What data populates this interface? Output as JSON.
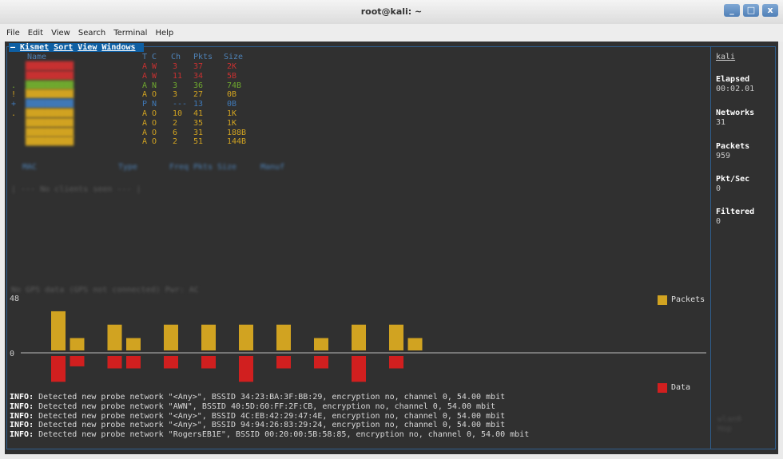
{
  "window": {
    "title": "root@kali: ~",
    "controls": [
      "_",
      "□",
      "x"
    ]
  },
  "menubar": {
    "items": [
      "File",
      "Edit",
      "View",
      "Search",
      "Terminal",
      "Help"
    ]
  },
  "kismet": {
    "menu_items": [
      "Kismet",
      "Sort",
      "View",
      "Windows"
    ],
    "network_headers": {
      "name": "Name",
      "tc": "T C",
      "ch": "Ch",
      "pkts": "Pkts",
      "size": "Size"
    },
    "networks": [
      {
        "marker": " ",
        "name": "blurred",
        "tc": "A W",
        "ch": "3",
        "pkts": "37",
        "size": "2K",
        "color": "#c73131"
      },
      {
        "marker": " ",
        "name": "blurred",
        "tc": "A W",
        "ch": "11",
        "pkts": "34",
        "size": "5B",
        "color": "#c73131"
      },
      {
        "marker": ".",
        "name": "blurred",
        "tc": "A N",
        "ch": "3",
        "pkts": "36",
        "size": "74B",
        "color": "#6fa82f"
      },
      {
        "marker": "!",
        "name": "blurred",
        "tc": "A O",
        "ch": "3",
        "pkts": "27",
        "size": "0B",
        "color": "#d1a321"
      },
      {
        "marker": "+",
        "name": "blurred",
        "tc": "P N",
        "ch": "---",
        "pkts": "13",
        "size": "0B",
        "color": "#3f78b6"
      },
      {
        "marker": ".",
        "name": "blurred",
        "tc": "A O",
        "ch": "10",
        "pkts": "41",
        "size": "1K",
        "color": "#d1a321"
      },
      {
        "marker": " ",
        "name": "blurred",
        "tc": "A O",
        "ch": "2",
        "pkts": "35",
        "size": "1K",
        "color": "#d1a321"
      },
      {
        "marker": " ",
        "name": "blurred",
        "tc": "A O",
        "ch": "6",
        "pkts": "31",
        "size": "188B",
        "color": "#d1a321"
      },
      {
        "marker": " ",
        "name": "blurred",
        "tc": "A O",
        "ch": "2",
        "pkts": "51",
        "size": "144B",
        "color": "#d1a321"
      }
    ],
    "client_headers": [
      "MAC",
      "Type",
      "Freq",
      "Pkts",
      "Size",
      "Manuf"
    ],
    "no_clients": "| --- No clients seen --- |",
    "gps_status": "No GPS data (GPS not connected) Pwr: AC",
    "sidebar": {
      "hostname": "kali",
      "elapsed_label": "Elapsed",
      "elapsed_value": "00:02.01",
      "networks_label": "Networks",
      "networks_value": "31",
      "packets_label": "Packets",
      "packets_value": "959",
      "pktsec_label": "Pkt/Sec",
      "pktsec_value": "0",
      "filtered_label": "Filtered",
      "filtered_value": "0"
    },
    "footer": {
      "iface": "wlan0",
      "mode": "Hop"
    }
  },
  "chart_data": {
    "type": "bar",
    "y_max_label": "48",
    "zero_label": "0",
    "legend": [
      {
        "name": "Packets",
        "color": "#d1a321"
      },
      {
        "name": "Data",
        "color": "#d11f1f"
      }
    ],
    "series": [
      {
        "name": "Packets",
        "values": [
          38,
          12,
          0,
          25,
          12,
          0,
          25,
          0,
          25,
          0,
          25,
          0,
          25,
          0,
          12,
          0,
          25,
          0,
          25,
          12
        ]
      },
      {
        "name": "Data",
        "values": [
          25,
          10,
          0,
          12,
          12,
          0,
          12,
          0,
          12,
          0,
          25,
          0,
          12,
          0,
          12,
          0,
          25,
          0,
          12,
          0
        ]
      }
    ]
  },
  "log": {
    "level": "INFO",
    "lines": [
      "Detected new probe network \"<Any>\", BSSID 34:23:BA:3F:BB:29, encryption no, channel 0, 54.00 mbit",
      "Detected new probe network \"AWN\", BSSID 40:5D:60:FF:2F:CB, encryption no, channel 0, 54.00 mbit",
      "Detected new probe network \"<Any>\", BSSID 4C:EB:42:29:47:4E, encryption no, channel 0, 54.00 mbit",
      "Detected new probe network \"<Any>\", BSSID 94:94:26:83:29:24, encryption no, channel 0, 54.00 mbit",
      "Detected new probe network \"RogersEB1E\", BSSID 00:20:00:5B:58:85, encryption no, channel 0, 54.00 mbit"
    ]
  }
}
